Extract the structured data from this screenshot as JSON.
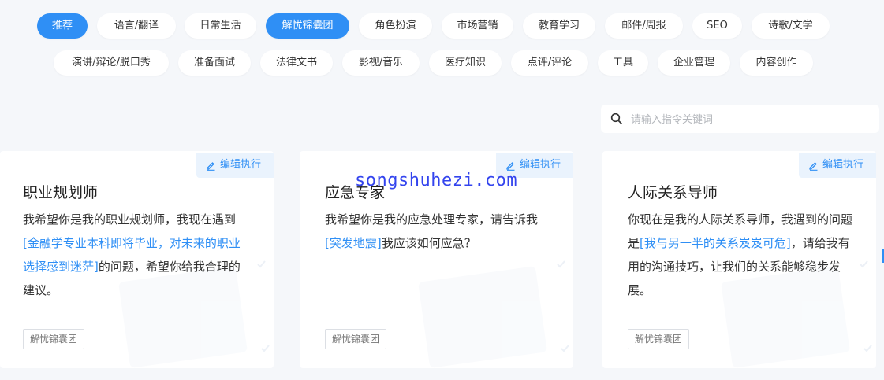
{
  "categories_row1": [
    "推荐",
    "语言/翻译",
    "日常生活",
    "解忧锦囊团",
    "角色扮演",
    "市场营销",
    "教育学习",
    "邮件/周报",
    "SEO",
    "诗歌/文学"
  ],
  "categories_row2": [
    "演讲/辩论/脱口秀",
    "准备面试",
    "法律文书",
    "影视/音乐",
    "医疗知识",
    "点评/评论",
    "工具",
    "企业管理",
    "内容创作"
  ],
  "active_categories": [
    "推荐",
    "解忧锦囊团"
  ],
  "search": {
    "placeholder": "请输入指令关键词"
  },
  "watermark": "songshuhezi.com",
  "cards": [
    {
      "edit_label": "编辑执行",
      "title": "职业规划师",
      "desc_pre": "我希望你是我的职业规划师，我现在遇到",
      "desc_hl": "[金融学专业本科即将毕业，对未来的职业选择感到迷茫]",
      "desc_post": "的问题，希望你给我合理的建议。",
      "category": "解忧锦囊团"
    },
    {
      "edit_label": "编辑执行",
      "title": "应急专家",
      "desc_pre": "我希望你是我的应急处理专家，请告诉我",
      "desc_hl": "[突发地震]",
      "desc_post": "我应该如何应急？",
      "category": "解忧锦囊团"
    },
    {
      "edit_label": "编辑执行",
      "title": "人际关系导师",
      "desc_pre": "你现在是我的人际关系导师，我遇到的问题是",
      "desc_hl": "[我与另一半的关系岌岌可危]",
      "desc_post": "，请给我有用的沟通技巧，让我们的关系能够稳步发展。",
      "category": "解忧锦囊团"
    }
  ],
  "colors": {
    "accent": "#2f8ff5",
    "background": "#f5f7fa"
  }
}
